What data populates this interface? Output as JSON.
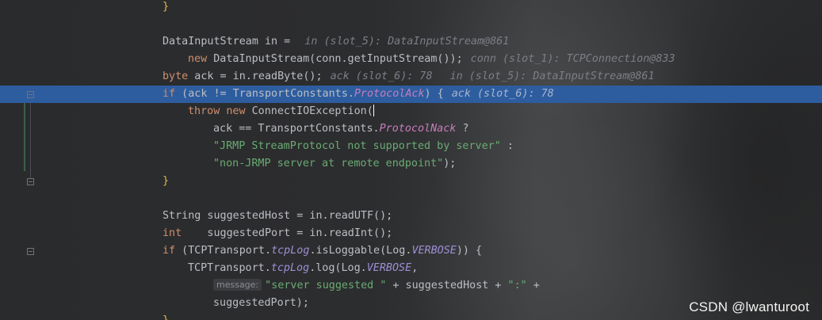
{
  "editor": {
    "lines": [
      {
        "t1": "}"
      },
      {
        "t1": ""
      },
      {
        "p1": "DataInputStream in = ",
        "hint": "in (slot_5): DataInputStream@861"
      },
      {
        "kw": "new",
        "p1": " DataInputStream(conn.getInputStream());",
        "hint": "conn (slot_1): TCPConnection@833"
      },
      {
        "kw": "byte",
        "p1": " ack = in.readByte();",
        "hint1": "ack (slot_6): 78",
        "hint2": "in (slot_5): DataInputStream@861"
      },
      {
        "kw": "if",
        "p1": " (ack != TransportConstants.",
        "fld": "ProtocolAck",
        "p2": ") {",
        "hint": "ack (slot_6): 78"
      },
      {
        "kw1": "throw",
        "kw2": "new",
        "p1": " ConnectIOException("
      },
      {
        "p1": "ack == TransportConstants.",
        "fld": "ProtocolNack",
        "p2": " ?"
      },
      {
        "str": "\"JRMP StreamProtocol not supported by server\"",
        "p2": " :"
      },
      {
        "str": "\"non-JRMP server at remote endpoint\"",
        "p2": ");"
      },
      {
        "t1": "}"
      },
      {
        "t1": ""
      },
      {
        "p1": "String suggestedHost = in.readUTF();"
      },
      {
        "kw": "int",
        "p1": "    suggestedPort = in.readInt();"
      },
      {
        "kw": "if",
        "p1": " (TCPTransport.",
        "sfn": "tcpLog",
        "p2": ".isLoggable(Log.",
        "sfn2": "VERBOSE",
        "p3": ")) {"
      },
      {
        "p1": "TCPTransport.",
        "sfn": "tcpLog",
        "p2": ".log(Log.",
        "sfn2": "VERBOSE",
        "p3": ","
      },
      {
        "param": "message:",
        "str": "\"server suggested \"",
        "p2": " + suggestedHost + ",
        "str2": "\":\"",
        "p3": " +"
      },
      {
        "p1": "suggestedPort);"
      },
      {
        "t1": "}"
      }
    ],
    "execution_line_color": "#2d5d9f"
  },
  "watermark": {
    "text": "CSDN @lwanturoot"
  }
}
